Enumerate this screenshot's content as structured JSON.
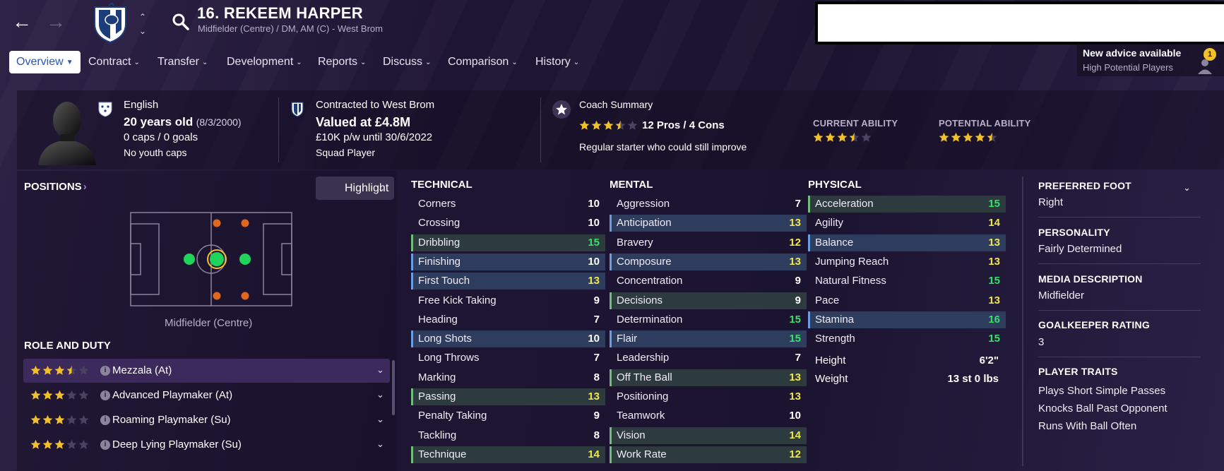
{
  "header": {
    "player_name": "16. REKEEM HARPER",
    "player_subtitle": "Midfielder (Centre) / DM, AM (C) - West Brom",
    "back_icon": "arrow-left-icon",
    "forward_icon": "arrow-right-icon",
    "search_icon": "search-icon"
  },
  "tabs": [
    {
      "label": "Overview"
    },
    {
      "label": "Contract"
    },
    {
      "label": "Transfer"
    },
    {
      "label": "Development"
    },
    {
      "label": "Reports"
    },
    {
      "label": "Discuss"
    },
    {
      "label": "Comparison"
    },
    {
      "label": "History"
    }
  ],
  "advice": {
    "title": "New advice available",
    "subtitle": "High Potential Players",
    "badge": "1"
  },
  "summary": {
    "nationality": "English",
    "age": "20 years old",
    "dob": "(8/3/2000)",
    "caps": "0 caps / 0 goals",
    "youth_caps": "No youth caps",
    "contract": "Contracted to West Brom",
    "value": "Valued at £4.8M",
    "wage": "£10K p/w until 30/6/2022",
    "squad_status": "Squad Player",
    "coach_summary_title": "Coach Summary",
    "coach_stars": 3.5,
    "pros_cons": "12 Pros / 4 Cons",
    "coach_comment": "Regular starter who could still improve",
    "current_ability_label": "CURRENT ABILITY",
    "current_ability_stars": 3.5,
    "potential_ability_label": "POTENTIAL ABILITY",
    "potential_ability_stars": 4.5
  },
  "positions": {
    "title": "POSITIONS",
    "highlight_label": "Highlight",
    "position_label": "Midfielder (Centre)"
  },
  "roles": {
    "title": "ROLE AND DUTY",
    "items": [
      {
        "name": "Mezzala (At)",
        "stars": 3.5,
        "selected": true
      },
      {
        "name": "Advanced Playmaker (At)",
        "stars": 3,
        "selected": false
      },
      {
        "name": "Roaming Playmaker (Su)",
        "stars": 3,
        "selected": false
      },
      {
        "name": "Deep Lying Playmaker (Su)",
        "stars": 3,
        "selected": false
      }
    ]
  },
  "attributes": {
    "technical_title": "TECHNICAL",
    "mental_title": "MENTAL",
    "physical_title": "PHYSICAL",
    "technical": [
      {
        "name": "Corners",
        "value": 10,
        "hl": ""
      },
      {
        "name": "Crossing",
        "value": 10,
        "hl": ""
      },
      {
        "name": "Dribbling",
        "value": 15,
        "hl": "green"
      },
      {
        "name": "Finishing",
        "value": 10,
        "hl": "blue"
      },
      {
        "name": "First Touch",
        "value": 13,
        "hl": "blue"
      },
      {
        "name": "Free Kick Taking",
        "value": 9,
        "hl": ""
      },
      {
        "name": "Heading",
        "value": 7,
        "hl": ""
      },
      {
        "name": "Long Shots",
        "value": 10,
        "hl": "blue"
      },
      {
        "name": "Long Throws",
        "value": 7,
        "hl": ""
      },
      {
        "name": "Marking",
        "value": 8,
        "hl": ""
      },
      {
        "name": "Passing",
        "value": 13,
        "hl": "green"
      },
      {
        "name": "Penalty Taking",
        "value": 9,
        "hl": ""
      },
      {
        "name": "Tackling",
        "value": 8,
        "hl": ""
      },
      {
        "name": "Technique",
        "value": 14,
        "hl": "green"
      }
    ],
    "mental": [
      {
        "name": "Aggression",
        "value": 7,
        "hl": ""
      },
      {
        "name": "Anticipation",
        "value": 13,
        "hl": "blue"
      },
      {
        "name": "Bravery",
        "value": 12,
        "hl": ""
      },
      {
        "name": "Composure",
        "value": 13,
        "hl": "blue"
      },
      {
        "name": "Concentration",
        "value": 9,
        "hl": ""
      },
      {
        "name": "Decisions",
        "value": 9,
        "hl": "green"
      },
      {
        "name": "Determination",
        "value": 15,
        "hl": ""
      },
      {
        "name": "Flair",
        "value": 15,
        "hl": "blue"
      },
      {
        "name": "Leadership",
        "value": 7,
        "hl": ""
      },
      {
        "name": "Off The Ball",
        "value": 13,
        "hl": "green"
      },
      {
        "name": "Positioning",
        "value": 13,
        "hl": ""
      },
      {
        "name": "Teamwork",
        "value": 10,
        "hl": ""
      },
      {
        "name": "Vision",
        "value": 14,
        "hl": "green"
      },
      {
        "name": "Work Rate",
        "value": 12,
        "hl": "green"
      }
    ],
    "physical": [
      {
        "name": "Acceleration",
        "value": 15,
        "hl": "green"
      },
      {
        "name": "Agility",
        "value": 14,
        "hl": ""
      },
      {
        "name": "Balance",
        "value": 13,
        "hl": "blue"
      },
      {
        "name": "Jumping Reach",
        "value": 13,
        "hl": ""
      },
      {
        "name": "Natural Fitness",
        "value": 15,
        "hl": ""
      },
      {
        "name": "Pace",
        "value": 13,
        "hl": ""
      },
      {
        "name": "Stamina",
        "value": 16,
        "hl": "blue"
      },
      {
        "name": "Strength",
        "value": 15,
        "hl": ""
      }
    ],
    "height_label": "Height",
    "height": "6'2\"",
    "weight_label": "Weight",
    "weight": "13 st 0 lbs"
  },
  "info": {
    "preferred_foot_title": "PREFERRED FOOT",
    "preferred_foot": "Right",
    "personality_title": "PERSONALITY",
    "personality": "Fairly Determined",
    "media_title": "MEDIA DESCRIPTION",
    "media": "Midfielder",
    "gk_title": "GOALKEEPER RATING",
    "gk": "3",
    "traits_title": "PLAYER TRAITS",
    "traits": [
      "Plays Short Simple Passes",
      "Knocks Ball Past Opponent",
      "Runs With Ball Often"
    ]
  },
  "colors": {
    "accent_blue": "#2a56b8",
    "value_white": "#ffffff",
    "value_yellow": "#f2e64a",
    "value_green": "#36e06a",
    "star_gold": "#f2c029"
  }
}
